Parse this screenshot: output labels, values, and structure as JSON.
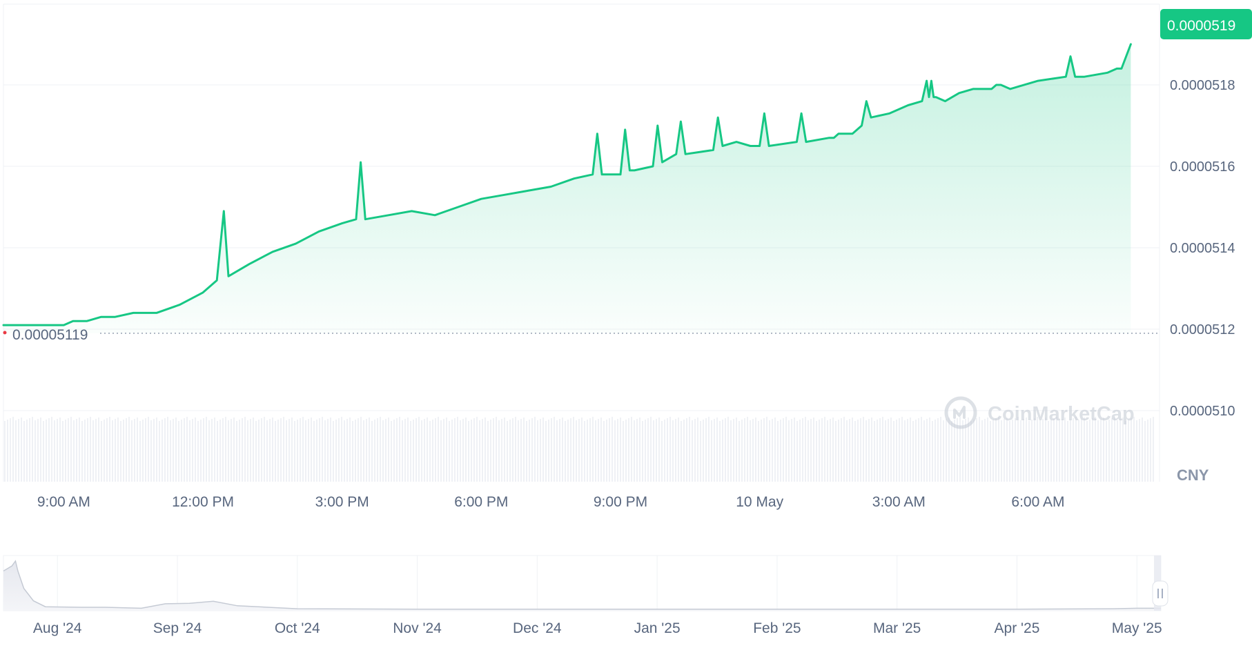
{
  "currency_label": "CNY",
  "watermark": "CoinMarketCap",
  "reference_price_label": "0.00005119",
  "current_price_label": "0.0000519",
  "colors": {
    "line": "#16c784",
    "area_top": "#16c784",
    "reference_dot": "#ea3943",
    "price_badge": "#16c784",
    "grid": "#eff2f5",
    "text": "#58667e",
    "volume": "#eff1f5"
  },
  "chart_data": {
    "type": "line",
    "title": "",
    "xlabel": "",
    "ylabel": "",
    "ylim": [
      5.1e-05,
      5.2e-05
    ],
    "y_ticks": [
      "0.0000518",
      "0.0000516",
      "0.0000514",
      "0.0000512",
      "0.0000510"
    ],
    "x_ticks": [
      "9:00 AM",
      "12:00 PM",
      "3:00 PM",
      "6:00 PM",
      "9:00 PM",
      "10 May",
      "3:00 AM",
      "6:00 AM"
    ],
    "x_tick_hours": [
      9,
      12,
      15,
      18,
      21,
      24,
      27,
      30
    ],
    "x_range_hours": [
      7.7,
      32.5
    ],
    "reference_value": 5.119e-05,
    "series": [
      {
        "x_hours": [
          7.7,
          8.5,
          9.0,
          9.2,
          9.5,
          9.8,
          10.1,
          10.5,
          11.0,
          11.5,
          12.0,
          12.3,
          12.45,
          12.55,
          13.0,
          13.5,
          14.0,
          14.5,
          15.0,
          15.3,
          15.4,
          15.5,
          16.0,
          16.5,
          17.0,
          17.5,
          18.0,
          18.5,
          19.0,
          19.5,
          20.0,
          20.4,
          20.5,
          20.6,
          21.0,
          21.1,
          21.2,
          21.3,
          21.7,
          21.8,
          21.9,
          22.2,
          22.3,
          22.4,
          23.0,
          23.1,
          23.2,
          23.5,
          23.8,
          24.0,
          24.1,
          24.2,
          24.8,
          24.9,
          25.0,
          25.5,
          25.6,
          25.7,
          26.0,
          26.2,
          26.3,
          26.4,
          26.8,
          27.2,
          27.5,
          27.6,
          27.65,
          27.7,
          27.75,
          27.8,
          28.0,
          28.3,
          28.6,
          29.0,
          29.1,
          29.2,
          29.4,
          30.0,
          30.6,
          30.7,
          30.8,
          31.0,
          31.5,
          31.7,
          31.8,
          32.0
        ],
        "values": [
          5.121e-05,
          5.121e-05,
          5.121e-05,
          5.122e-05,
          5.122e-05,
          5.123e-05,
          5.123e-05,
          5.124e-05,
          5.124e-05,
          5.126e-05,
          5.129e-05,
          5.132e-05,
          5.149e-05,
          5.133e-05,
          5.136e-05,
          5.139e-05,
          5.141e-05,
          5.144e-05,
          5.146e-05,
          5.147e-05,
          5.161e-05,
          5.147e-05,
          5.148e-05,
          5.149e-05,
          5.148e-05,
          5.15e-05,
          5.152e-05,
          5.153e-05,
          5.154e-05,
          5.155e-05,
          5.157e-05,
          5.158e-05,
          5.168e-05,
          5.158e-05,
          5.158e-05,
          5.169e-05,
          5.159e-05,
          5.159e-05,
          5.16e-05,
          5.17e-05,
          5.161e-05,
          5.163e-05,
          5.171e-05,
          5.163e-05,
          5.164e-05,
          5.172e-05,
          5.165e-05,
          5.166e-05,
          5.165e-05,
          5.165e-05,
          5.173e-05,
          5.165e-05,
          5.166e-05,
          5.173e-05,
          5.166e-05,
          5.167e-05,
          5.167e-05,
          5.168e-05,
          5.168e-05,
          5.17e-05,
          5.176e-05,
          5.172e-05,
          5.173e-05,
          5.175e-05,
          5.176e-05,
          5.181e-05,
          5.177e-05,
          5.181e-05,
          5.177e-05,
          5.177e-05,
          5.176e-05,
          5.178e-05,
          5.179e-05,
          5.179e-05,
          5.18e-05,
          5.18e-05,
          5.179e-05,
          5.181e-05,
          5.182e-05,
          5.187e-05,
          5.182e-05,
          5.182e-05,
          5.183e-05,
          5.184e-05,
          5.184e-05,
          5.19e-05
        ],
        "name": ""
      }
    ],
    "navigator": {
      "x_ticks": [
        "Aug '24",
        "Sep '24",
        "Oct '24",
        "Nov '24",
        "Dec '24",
        "Jan '25",
        "Feb '25",
        "Mar '25",
        "Apr '25",
        "May '25"
      ],
      "x_tick_months": [
        0,
        1,
        2,
        3,
        4,
        5,
        6,
        7,
        8,
        9
      ],
      "x_range_months": [
        -0.45,
        9.2
      ],
      "x_months": [
        -0.45,
        -0.38,
        -0.35,
        -0.33,
        -0.28,
        -0.2,
        -0.1,
        0.2,
        0.4,
        0.7,
        0.9,
        1.1,
        1.3,
        1.5,
        2.0,
        3.0,
        4.0,
        5.0,
        6.0,
        7.0,
        8.0,
        8.8,
        9.0,
        9.2
      ],
      "values": [
        0.8,
        0.9,
        1.0,
        0.8,
        0.45,
        0.2,
        0.08,
        0.07,
        0.07,
        0.05,
        0.14,
        0.15,
        0.19,
        0.1,
        0.04,
        0.03,
        0.03,
        0.03,
        0.03,
        0.03,
        0.03,
        0.04,
        0.05,
        0.05
      ]
    }
  }
}
